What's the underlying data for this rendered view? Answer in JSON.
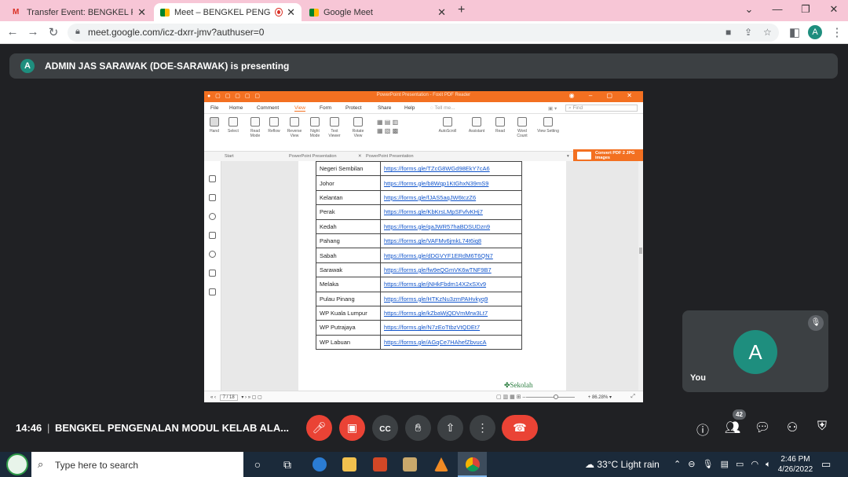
{
  "browser": {
    "tabs": [
      {
        "label": "Transfer Event: BENGKEL PENGEN",
        "icon": "gmail-icon",
        "active": false
      },
      {
        "label": "Meet – BENGKEL PENGENAL",
        "icon": "meet-icon",
        "active": true,
        "recording": true
      },
      {
        "label": "Google Meet",
        "icon": "meet-icon",
        "active": false
      }
    ],
    "new_tab": "+",
    "url": "meet.google.com/icz-dxrr-jmv?authuser=0",
    "profile_initial": "A"
  },
  "meet": {
    "presenting_initial": "A",
    "presenting_text": "ADMIN JAS SARAWAK (DOE-SARAWAK) is presenting",
    "time": "14:46",
    "separator": "|",
    "meeting_name": "BENGKEL PENGENALAN MODUL KELAB ALA...",
    "self_initial": "A",
    "self_label": "You",
    "participants_count": "42",
    "colors": {
      "end_call": "#ea4335",
      "muted": "#ea4335",
      "avatar": "#1e8e7e"
    }
  },
  "pdf": {
    "window_title": "PowerPoint Presentation - Foxit PDF Reader",
    "find_placeholder": "Find",
    "tell_me": "Tell me...",
    "menu": [
      "File",
      "Home",
      "Comment",
      "View",
      "Form",
      "Protect",
      "Share",
      "Help"
    ],
    "active_menu": "View",
    "ribbon": [
      {
        "label": "Hand"
      },
      {
        "label": "Select"
      },
      {
        "label": "Read Mode"
      },
      {
        "label": "Reflow"
      },
      {
        "label": "Reverse View"
      },
      {
        "label": "Night Mode"
      },
      {
        "label": "Text Viewer"
      },
      {
        "label": "Rotate View"
      },
      {
        "label": "AutoScroll"
      },
      {
        "label": "Assistant"
      },
      {
        "label": "Read"
      },
      {
        "label": "Word Count"
      },
      {
        "label": "View Setting"
      }
    ],
    "doc_tabs": [
      "Start",
      "PowerPoint Presentation",
      "PowerPoint Presentation"
    ],
    "convert_label": "Convert PDF 2 JPG images",
    "rows": [
      {
        "state": "Negeri Sembilan",
        "url": "https://forms.gle/TZcG8WGd98EkY7cA6"
      },
      {
        "state": "Johor",
        "url": "https://forms.gle/b8Wqp1KtGhxN39mS9"
      },
      {
        "state": "Kelantan",
        "url": "https://forms.gle/fJAS5aqJW6tczZ6"
      },
      {
        "state": "Perak",
        "url": "https://forms.gle/KbKrsLMpSFvfvKHj7"
      },
      {
        "state": "Kedah",
        "url": "https://forms.gle/qaJWR57haBDSUDzn9"
      },
      {
        "state": "Pahang",
        "url": "https://forms.gle/VAFMv6jmkL74t6iq8"
      },
      {
        "state": "Sabah",
        "url": "https://forms.gle/dDGVYF1ERdM6T6QN7"
      },
      {
        "state": "Sarawak",
        "url": "https://forms.gle/fw9eQGmVK6wTNF9B7"
      },
      {
        "state": "Melaka",
        "url": "https://forms.gle/jNHkFbdm14X2xSXv9"
      },
      {
        "state": "Pulau Pinang",
        "url": "https://forms.gle/HTKzNu3zmPAHvkyq9"
      },
      {
        "state": "WP Kuala Lumpur",
        "url": "https://forms.gle/kZbaWjQDVmMrw3Lt7"
      },
      {
        "state": "WP Putrajaya",
        "url": "https://forms.gle/N7zEoTtbzVtQDEt7"
      },
      {
        "state": "WP Labuan",
        "url": "https://forms.gle/AGqCe7HAhefZbvucA"
      }
    ],
    "footer_logo": "Sekolah",
    "page_current": "7 / 18",
    "zoom": "86.28%"
  },
  "taskbar": {
    "search_placeholder": "Type here to search",
    "weather": "33°C  Light rain",
    "time": "2:46 PM",
    "date": "4/26/2022"
  }
}
